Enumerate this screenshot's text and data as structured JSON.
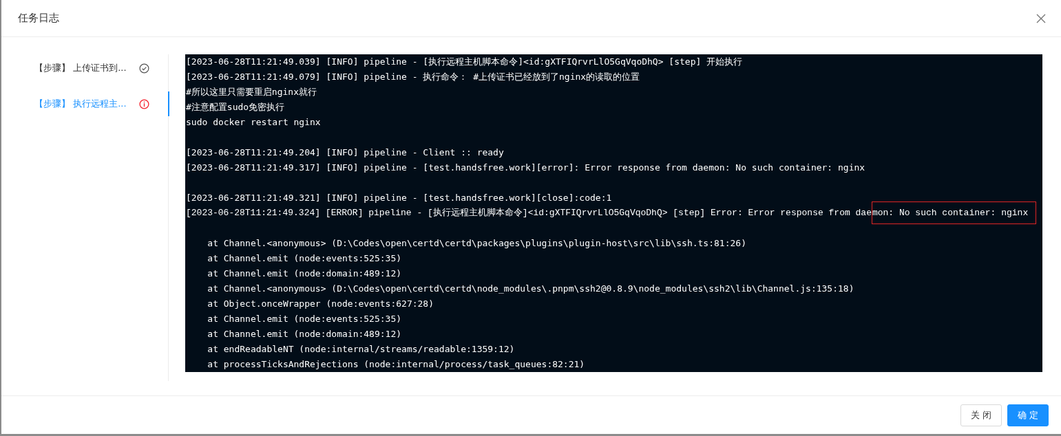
{
  "dialog": {
    "title": "任务日志"
  },
  "steps": [
    {
      "label": "【步骤】 上传证书到...",
      "kind": "success",
      "selected": false
    },
    {
      "label": "【步骤】 执行远程主...",
      "kind": "error",
      "selected": true
    }
  ],
  "log": [
    {
      "text": "[2023-06-28T11:21:49.039] [INFO] pipeline - [执行远程主机脚本命令]<id:gXTFIQrvrLlO5GqVqoDhQ> [step] 开始执行"
    },
    {
      "text": "[2023-06-28T11:21:49.079] [INFO] pipeline - 执行命令： #上传证书已经放到了nginx的读取的位置\n#所以这里只需要重启nginx就行\n#注意配置sudo免密执行\nsudo docker restart nginx\n"
    },
    {
      "text": "[2023-06-28T11:21:49.204] [INFO] pipeline - Client :: ready"
    },
    {
      "text": "[2023-06-28T11:21:49.317] [INFO] pipeline - [test.handsfree.work][error]: Error response from daemon: No such container: nginx\n"
    },
    {
      "text": "[2023-06-28T11:21:49.321] [INFO] pipeline - [test.handsfree.work][close]:code:1"
    },
    {
      "segments": [
        {
          "text": "[2023-06-28T11:21:49.324] [ERROR] pipeline - [执行远程主机脚本命令]<id:gXTFIQrvrLlO5GqVqoDhQ> [step] Error: Error response from dae",
          "highlighted": false
        },
        {
          "text": "mon: No such container: nginx",
          "highlighted": true
        }
      ]
    },
    {
      "text": "    at Channel.<anonymous> (D:\\Codes\\open\\certd\\certd\\packages\\plugins\\plugin-host\\src\\lib\\ssh.ts:81:26)\n    at Channel.emit (node:events:525:35)\n    at Channel.emit (node:domain:489:12)\n    at Channel.<anonymous> (D:\\Codes\\open\\certd\\certd\\node_modules\\.pnpm\\ssh2@0.8.9\\node_modules\\ssh2\\lib\\Channel.js:135:18)\n    at Object.onceWrapper (node:events:627:28)\n    at Channel.emit (node:events:525:35)\n    at Channel.emit (node:domain:489:12)\n    at endReadableNT (node:internal/streams/readable:1359:12)\n    at processTicksAndRejections (node:internal/process/task_queues:82:21)"
    }
  ],
  "buttons": [
    {
      "label": "关 闭",
      "kind": "default"
    },
    {
      "label": "确 定",
      "kind": "primary"
    }
  ]
}
